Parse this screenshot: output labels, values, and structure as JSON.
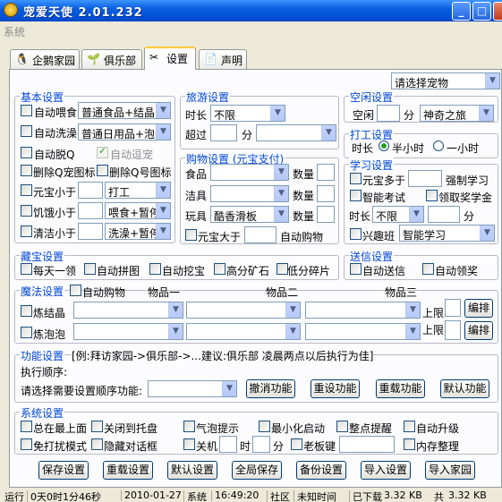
{
  "window": {
    "title": "宠爱天使 2.01.232"
  },
  "menu": {
    "system": "系统"
  },
  "tabs": [
    {
      "label": "企鹅家园",
      "icon": "penguin-icon"
    },
    {
      "label": "俱乐部",
      "icon": "plant-icon"
    },
    {
      "label": "设置",
      "icon": "tools-icon"
    },
    {
      "label": "声明",
      "icon": "document-icon"
    }
  ],
  "pet_select": "请选择宠物",
  "basic": {
    "title": "基本设置",
    "auto_feed": "自动喂食",
    "feed_combo": "普通食品+结晶",
    "auto_wash": "自动洗澡",
    "wash_combo": "普通日用品+泡沫",
    "auto_q": "自动脱Q",
    "auto_tease": "自动逗宠",
    "del_pet_icon": "删除Q宠图标",
    "del_qq_icon": "删除Q号图标",
    "coin_less": "元宝小于",
    "coin_combo": "打工",
    "hunger_less": "饥饿小于",
    "hunger_combo": "喂食+暂停",
    "clean_less": "清洁小于",
    "clean_combo": "洗澡+暂停"
  },
  "travel": {
    "title": "旅游设置",
    "duration": "时长",
    "duration_val": "不限",
    "over": "超过",
    "minute": "分"
  },
  "shop": {
    "title": "购物设置 (元宝支付)",
    "food": "食品",
    "clean": "洁具",
    "toy": "玩具",
    "toy_val": "酷香滑板",
    "qty": "数量",
    "coin_more": "元宝大于",
    "auto_buy": "自动购物"
  },
  "idle": {
    "title": "空闲设置",
    "label": "空闲",
    "minute": "分",
    "place": "神奇之旅"
  },
  "work": {
    "title": "打工设置",
    "duration": "时长",
    "half": "半小时",
    "one": "一小时"
  },
  "study": {
    "title": "学习设置",
    "coin_more": "元宝多于",
    "force": "强制学习",
    "smart_exam": "智能考试",
    "collect": "领取奖学金",
    "duration": "时长",
    "duration_val": "不限",
    "minute": "分",
    "interest": "兴趣班",
    "interest_val": "智能学习"
  },
  "treasure": {
    "title": "藏宝设置",
    "daily": "每天一领",
    "puzzle": "自动拼图",
    "dig": "自动挖宝",
    "mine": "高分矿石",
    "lowpiece": "低分碎片"
  },
  "gift": {
    "title": "送信设置",
    "auto_send": "自动送信",
    "auto_award": "自动领奖"
  },
  "magic": {
    "title": "魔法设置",
    "auto_buy": "自动购物",
    "item1": "物品一",
    "item2": "物品二",
    "item3": "物品三",
    "crystal": "炼结晶",
    "bubble": "炼泡泡",
    "limit": "上限",
    "edit": "编排"
  },
  "func": {
    "title": "功能设置",
    "hint": "[例:拜访家园->俱乐部->...建议:俱乐部 凌晨两点以后执行为佳]",
    "order": "执行顺序:",
    "choose": "请选择需要设置顺序功能:",
    "cancel": "撤消功能",
    "reset": "重设功能",
    "reload": "重载功能",
    "default": "默认功能"
  },
  "system": {
    "title": "系统设置",
    "top": "总在最上面",
    "tray": "关闭到托盘",
    "bubble": "气泡提示",
    "minstart": "最小化启动",
    "hourly": "整点提醒",
    "autoup": "自动升级",
    "nodisturb": "免打扰模式",
    "hidedlg": "隐藏对话框",
    "shutdown": "关机",
    "hour": "时",
    "minute": "分",
    "bosskey": "老板键",
    "memory": "内存整理"
  },
  "bottom_buttons": [
    "保存设置",
    "重载设置",
    "默认设置",
    "全局保存",
    "备份设置",
    "导入设置",
    "导入家园"
  ],
  "status": {
    "running": "运行",
    "elapsed": "0天0时1分46秒",
    "date": "2010-01-27",
    "sys": "系统",
    "time": "16:49:20",
    "community": "社区",
    "unknown": "未知时间",
    "downloaded": "已下载",
    "dl_size": "3.32 KB",
    "sent": "共",
    "sent_size": "3.32 KB"
  }
}
